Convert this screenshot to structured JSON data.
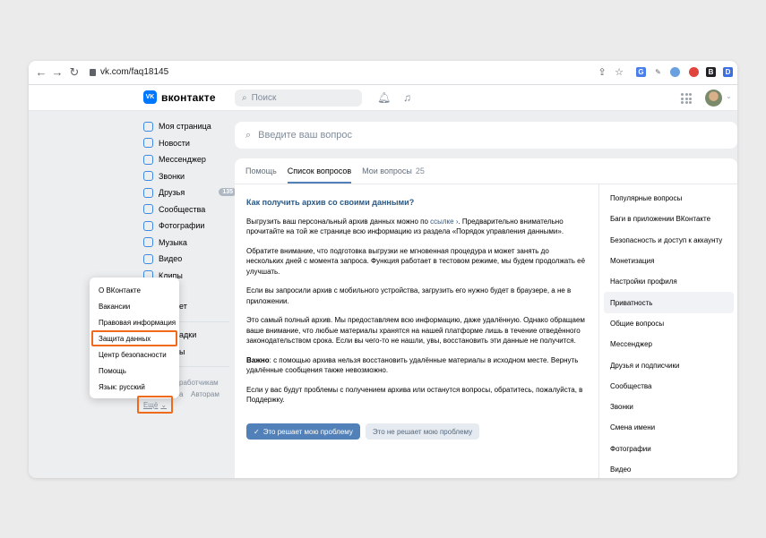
{
  "browser": {
    "url": "vk.com/faq18145",
    "extensions": [
      {
        "icon": "translate-icon",
        "color": "#4a7ee8"
      },
      {
        "icon": "pen-icon",
        "color": "#5f6368"
      },
      {
        "icon": "globe-icon",
        "color": "#6aa0e0"
      },
      {
        "icon": "red-circle-icon",
        "color": "#e0443c"
      },
      {
        "icon": "b-icon",
        "color": "#202124"
      },
      {
        "icon": "d-icon",
        "color": "#3c6fe0"
      }
    ]
  },
  "header": {
    "logo_mark": "VK",
    "logo_text": "вконтакте",
    "search_placeholder": "Поиск",
    "accent": "#0077ff"
  },
  "left_menu": {
    "items": [
      {
        "label": "Моя страница",
        "icon": "user-circle-icon"
      },
      {
        "label": "Новости",
        "icon": "news-icon"
      },
      {
        "label": "Мессенджер",
        "icon": "message-icon"
      },
      {
        "label": "Звонки",
        "icon": "phone-icon"
      },
      {
        "label": "Друзья",
        "icon": "friends-icon",
        "badge": "135"
      },
      {
        "label": "Сообщества",
        "icon": "groups-icon"
      },
      {
        "label": "Фотографии",
        "icon": "photo-icon"
      },
      {
        "label": "Музыка",
        "icon": "music-icon"
      },
      {
        "label": "Видео",
        "icon": "video-icon"
      },
      {
        "label": "Клипы",
        "icon": "clips-icon"
      }
    ],
    "partial_1": "ет",
    "partial_2": "адки",
    "partial_3": "ы",
    "footer_1": "работчикам",
    "footer_2": "а",
    "footer_3": "Авторам",
    "more_label": "Ещё",
    "more_chevron": "⌄"
  },
  "popup_menu": {
    "items": [
      "О ВКонтакте",
      "Вакансии",
      "Правовая информация",
      "Защита данных",
      "Центр безопасности",
      "Помощь",
      "Язык: русский"
    ],
    "highlighted": "Защита данных"
  },
  "question_search": {
    "placeholder": "Введите ваш вопрос"
  },
  "tabs": [
    {
      "label": "Помощь"
    },
    {
      "label": "Список вопросов"
    },
    {
      "label": "Мои вопросы",
      "count": "25"
    }
  ],
  "article": {
    "title": "Как получить архив со своими данными?",
    "p1_before": "Выгрузить ваш персональный архив данных можно по ",
    "p1_link": "ссылке",
    "p1_after": ". Предварительно внимательно прочитайте на той же странице всю информацию из раздела «Порядок управления данными».",
    "p2": "Обратите внимание, что подготовка выгрузки не мгновенная процедура и может занять до нескольких дней с момента запроса. Функция работает в тестовом режиме, мы будем продолжать её улучшать.",
    "p3": "Если вы запросили архив с мобильного устройства, загрузить его нужно будет в браузере, а не в приложении.",
    "p4": "Это самый полный архив. Мы предоставляем всю информацию, даже удалённую. Однако обращаем ваше внимание, что любые материалы хранятся на нашей платформе лишь в течение отведённого законодательством срока. Если вы чего-то не нашли, увы, восстановить эти данные не получится.",
    "p5_bold": "Важно",
    "p5_rest": ": с помощью архива нельзя восстановить удалённые материалы в исходном месте. Вернуть удалённые сообщения также невозможно.",
    "p6": "Если у вас будут проблемы с получением архива или останутся вопросы, обратитесь, пожалуйста, в Поддержку.",
    "btn_yes": "Это решает мою проблему",
    "btn_no": "Это не решает мою проблему"
  },
  "categories": {
    "items": [
      "Популярные вопросы",
      "Баги в приложении ВКонтакте",
      "Безопасность и доступ к аккаунту",
      "Монетизация",
      "Настройки профиля",
      "Приватность",
      "Общие вопросы",
      "Мессенджер",
      "Друзья и подписчики",
      "Сообщества",
      "Звонки",
      "Смена имени",
      "Фотографии",
      "Видео"
    ],
    "selected": "Приватность"
  },
  "colors": {
    "highlight": "#f06a1c",
    "link": "#2a5885",
    "button": "#5181b8"
  }
}
